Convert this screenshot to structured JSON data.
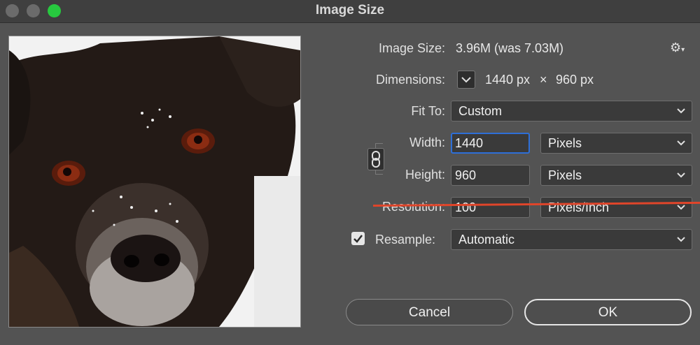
{
  "window": {
    "title": "Image Size"
  },
  "info": {
    "image_size_label": "Image Size:",
    "image_size_value": "3.96M (was 7.03M)",
    "dimensions_label": "Dimensions:",
    "dimensions_width": "1440 px",
    "dimensions_times": "×",
    "dimensions_height": "960 px"
  },
  "fit_to": {
    "label": "Fit To:",
    "value": "Custom"
  },
  "width": {
    "label": "Width:",
    "value": "1440",
    "unit": "Pixels"
  },
  "height": {
    "label": "Height:",
    "value": "960",
    "unit": "Pixels"
  },
  "resolution": {
    "label": "Resolution:",
    "value": "100",
    "unit": "Pixels/Inch"
  },
  "resample": {
    "label": "Resample:",
    "value": "Automatic",
    "checked": true
  },
  "buttons": {
    "cancel": "Cancel",
    "ok": "OK"
  },
  "icons": {
    "settings": "gear-icon",
    "link": "chain-link-icon",
    "dimensions_toggle": "chevron-down-icon",
    "checkbox": "checkmark-icon"
  },
  "colors": {
    "accent_focus": "#2e6fd8",
    "strike_line": "#e0452a",
    "maximize": "#27c93f"
  }
}
